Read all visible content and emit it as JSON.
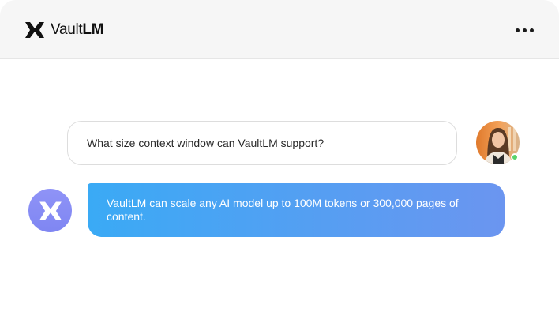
{
  "app": {
    "brand_light": "Vault",
    "brand_bold": "LM",
    "menu_icon": "more-horizontal-icon"
  },
  "conversation": {
    "user_message": "What size context window can VaultLM support?",
    "bot_message": "VaultLM can scale any AI model up to 100M tokens or 300,000 pages of content."
  },
  "colors": {
    "header_bg": "#f6f6f6",
    "bot_bubble_start": "#3aaaf5",
    "bot_bubble_end": "#6b95f0",
    "bot_avatar": "#8f93f7",
    "online_status": "#5ad36b"
  }
}
